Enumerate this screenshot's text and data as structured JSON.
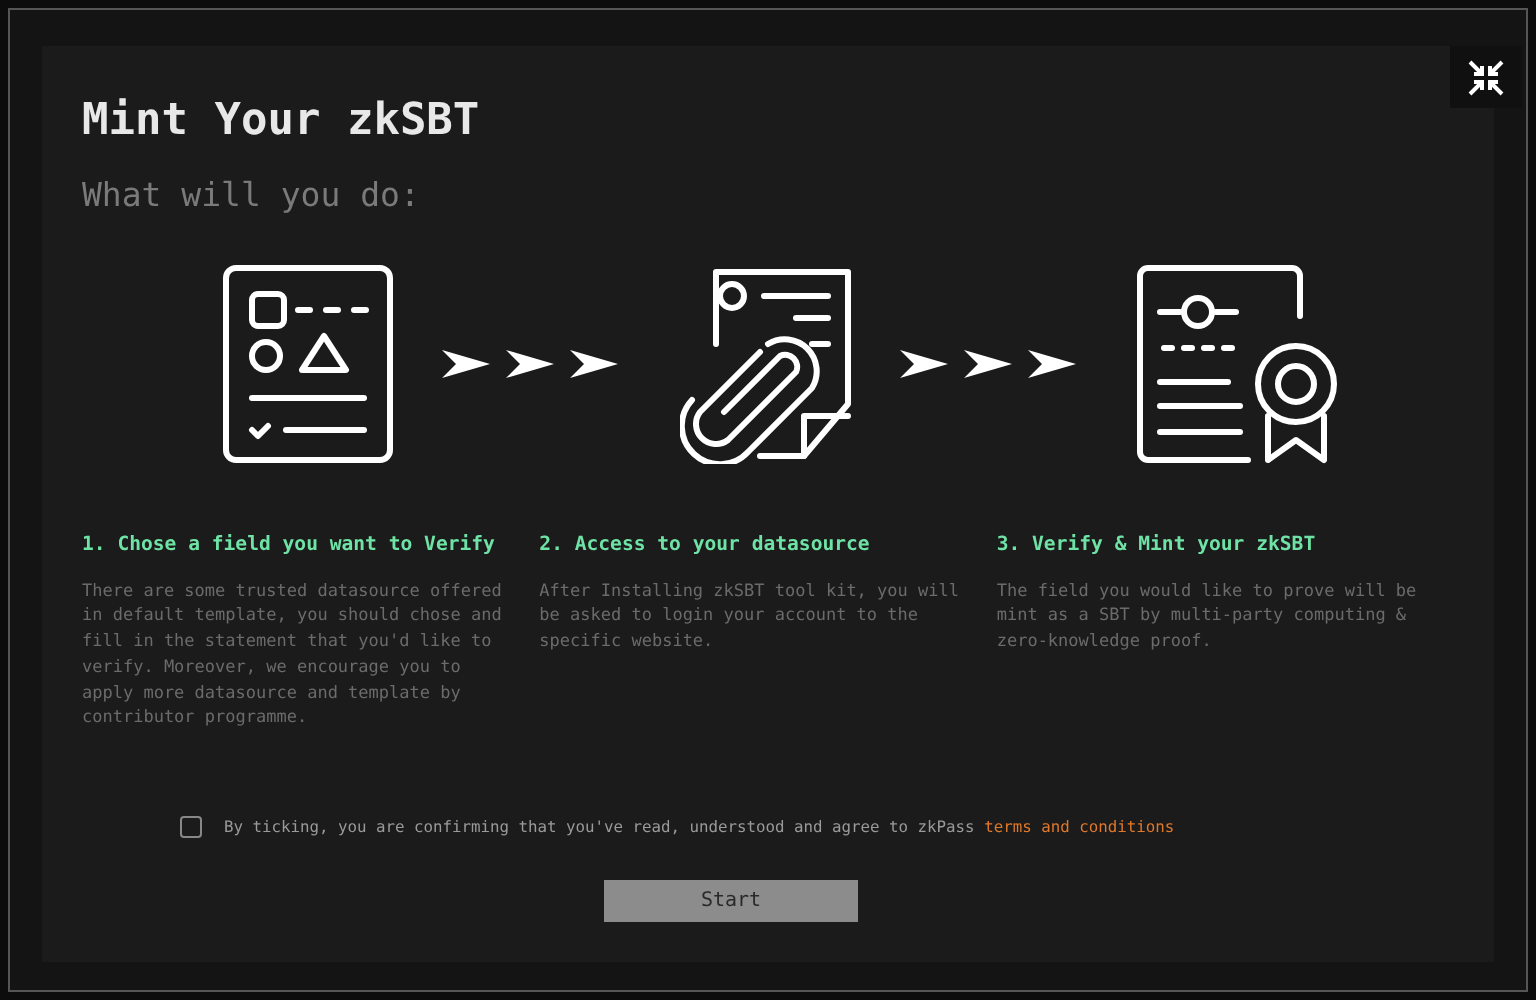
{
  "dialog": {
    "title": "Mint Your zkSBT",
    "subtitle": "What will you do:"
  },
  "steps": [
    {
      "kind": "form",
      "title": "1. Chose a field you want to Verify",
      "body": "There are some trusted datasource offered in default template, you should chose and fill in the statement that you'd like to verify. Moreover, we encourage you to apply more datasource and template by contributor programme."
    },
    {
      "kind": "attachment",
      "title": "2. Access to your datasource",
      "body": "After Installing zkSBT tool kit, you will be asked to login your account to the specific website."
    },
    {
      "kind": "certificate",
      "title": "3. Verify & Mint your zkSBT",
      "body": "The field you would like to prove will be mint as a SBT by multi-party computing & zero-knowledge proof."
    }
  ],
  "agreement": {
    "checked": false,
    "text": "By ticking, you are confirming that you've read, understood and agree to zkPass",
    "link": "terms and conditions"
  },
  "start_button": {
    "label": "Start",
    "disabled": true
  }
}
